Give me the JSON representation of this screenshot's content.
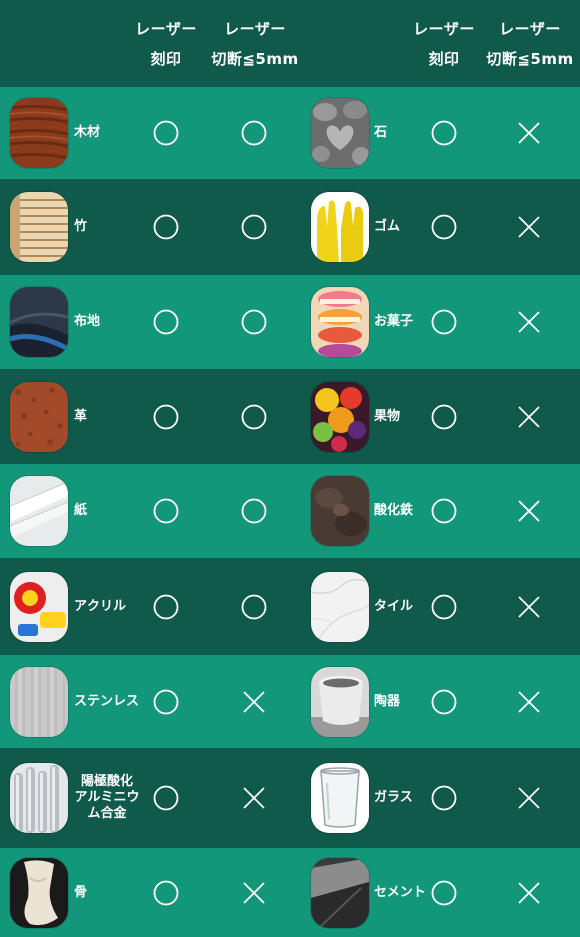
{
  "header": {
    "col_engrave_line1": "レーザー",
    "col_engrave_line2": "刻印",
    "col_cut_line1": "レーザー",
    "col_cut_line2": "切断≦5mm"
  },
  "legend": {
    "circle": "〇",
    "cross": "×"
  },
  "colors": {
    "row_light": "#13977b",
    "row_dark": "#0f5a4a",
    "mark": "#ffffff"
  },
  "left_materials": [
    {
      "name": "木材",
      "engrave": "circle",
      "cut": "circle",
      "image": "wood-texture"
    },
    {
      "name": "竹",
      "engrave": "circle",
      "cut": "circle",
      "image": "bamboo-blind"
    },
    {
      "name": "布地",
      "engrave": "circle",
      "cut": "circle",
      "image": "fabric"
    },
    {
      "name": "革",
      "engrave": "circle",
      "cut": "circle",
      "image": "leather"
    },
    {
      "name": "紙",
      "engrave": "circle",
      "cut": "circle",
      "image": "paper"
    },
    {
      "name": "アクリル",
      "engrave": "circle",
      "cut": "circle",
      "image": "acrylic"
    },
    {
      "name": "ステンレス",
      "engrave": "circle",
      "cut": "cross",
      "image": "stainless"
    },
    {
      "name": "陽極酸化アルミニウム合金",
      "engrave": "circle",
      "cut": "cross",
      "image": "aluminum-rods"
    },
    {
      "name": "骨",
      "engrave": "circle",
      "cut": "cross",
      "image": "bone"
    }
  ],
  "right_materials": [
    {
      "name": "石",
      "engrave": "circle",
      "cut": "cross",
      "image": "stones"
    },
    {
      "name": "ゴム",
      "engrave": "circle",
      "cut": "cross",
      "image": "rubber-gloves"
    },
    {
      "name": "お菓子",
      "engrave": "circle",
      "cut": "cross",
      "image": "macarons"
    },
    {
      "name": "果物",
      "engrave": "circle",
      "cut": "cross",
      "image": "fruits"
    },
    {
      "name": "酸化鉄",
      "engrave": "circle",
      "cut": "cross",
      "image": "iron-oxide"
    },
    {
      "name": "タイル",
      "engrave": "circle",
      "cut": "cross",
      "image": "marble-tile"
    },
    {
      "name": "陶器",
      "engrave": "circle",
      "cut": "cross",
      "image": "ceramic-cup"
    },
    {
      "name": "ガラス",
      "engrave": "circle",
      "cut": "cross",
      "image": "glass"
    },
    {
      "name": "セメント",
      "engrave": "circle",
      "cut": "cross",
      "image": "cement"
    }
  ],
  "labels_multiline": {
    "anodized_line1": "陽極酸化",
    "anodized_line2": "アルミニウ",
    "anodized_line3": "ム合金"
  }
}
